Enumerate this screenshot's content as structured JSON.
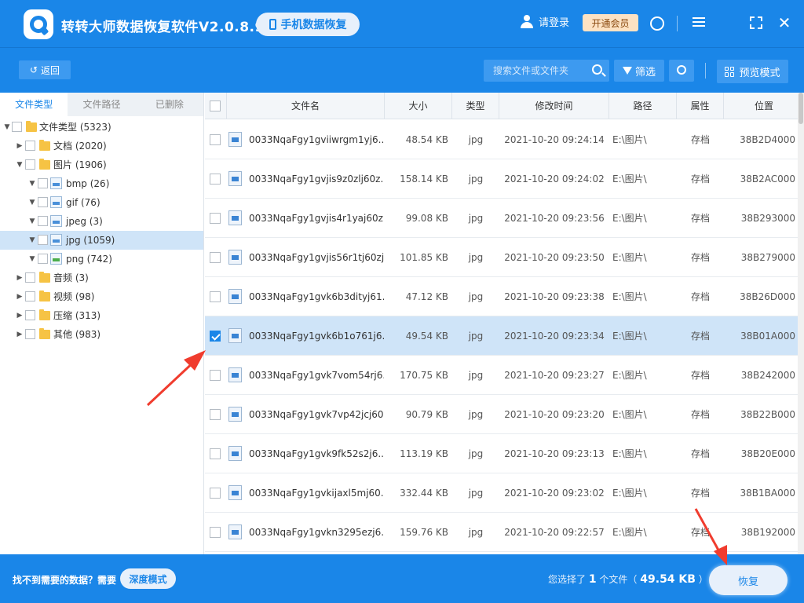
{
  "app": {
    "title": "转转大师数据恢复软件V2.0.8.9",
    "mobile_btn": "手机数据恢复",
    "login": "请登录",
    "vip": "开通会员"
  },
  "toolbar": {
    "back": "返回",
    "search_placeholder": "搜索文件或文件夹",
    "filter": "筛选",
    "preview_mode": "预览模式"
  },
  "sidebar": {
    "tabs": [
      "文件类型",
      "文件路径",
      "已删除"
    ],
    "tree": [
      {
        "label": "文件类型 (5323)"
      },
      {
        "label": "文档 (2020)"
      },
      {
        "label": "图片 (1906)"
      },
      {
        "label": "bmp (26)"
      },
      {
        "label": "gif (76)"
      },
      {
        "label": "jpeg (3)"
      },
      {
        "label": "jpg (1059)"
      },
      {
        "label": "png (742)"
      },
      {
        "label": "音频 (3)"
      },
      {
        "label": "视频 (98)"
      },
      {
        "label": "压缩 (313)"
      },
      {
        "label": "其他 (983)"
      }
    ]
  },
  "table": {
    "columns": [
      "文件名",
      "大小",
      "类型",
      "修改时间",
      "路径",
      "属性",
      "位置"
    ],
    "rows": [
      {
        "name": "0033NqaFgy1gviiwrgm1yj6...",
        "size": "48.54 KB",
        "type": "jpg",
        "time": "2021-10-20 09:24:14",
        "path": "E:\\图片\\",
        "attr": "存档",
        "pos": "38B2D4000",
        "checked": false
      },
      {
        "name": "0033NqaFgy1gvjis9z0zlj60z...",
        "size": "158.14 KB",
        "type": "jpg",
        "time": "2021-10-20 09:24:02",
        "path": "E:\\图片\\",
        "attr": "存档",
        "pos": "38B2AC000",
        "checked": false
      },
      {
        "name": "0033NqaFgy1gvjis4r1yaj60z...",
        "size": "99.08 KB",
        "type": "jpg",
        "time": "2021-10-20 09:23:56",
        "path": "E:\\图片\\",
        "attr": "存档",
        "pos": "38B293000",
        "checked": false
      },
      {
        "name": "0033NqaFgy1gvjis56r1tj60zj...",
        "size": "101.85 KB",
        "type": "jpg",
        "time": "2021-10-20 09:23:50",
        "path": "E:\\图片\\",
        "attr": "存档",
        "pos": "38B279000",
        "checked": false
      },
      {
        "name": "0033NqaFgy1gvk6b3dityj61...",
        "size": "47.12 KB",
        "type": "jpg",
        "time": "2021-10-20 09:23:38",
        "path": "E:\\图片\\",
        "attr": "存档",
        "pos": "38B26D000",
        "checked": false
      },
      {
        "name": "0033NqaFgy1gvk6b1o761j6...",
        "size": "49.54 KB",
        "type": "jpg",
        "time": "2021-10-20 09:23:34",
        "path": "E:\\图片\\",
        "attr": "存档",
        "pos": "38B01A000",
        "checked": true
      },
      {
        "name": "0033NqaFgy1gvk7vom54rj6...",
        "size": "170.75 KB",
        "type": "jpg",
        "time": "2021-10-20 09:23:27",
        "path": "E:\\图片\\",
        "attr": "存档",
        "pos": "38B242000",
        "checked": false
      },
      {
        "name": "0033NqaFgy1gvk7vp42jcj60...",
        "size": "90.79 KB",
        "type": "jpg",
        "time": "2021-10-20 09:23:20",
        "path": "E:\\图片\\",
        "attr": "存档",
        "pos": "38B22B000",
        "checked": false
      },
      {
        "name": "0033NqaFgy1gvk9fk52s2j6...",
        "size": "113.19 KB",
        "type": "jpg",
        "time": "2021-10-20 09:23:13",
        "path": "E:\\图片\\",
        "attr": "存档",
        "pos": "38B20E000",
        "checked": false
      },
      {
        "name": "0033NqaFgy1gvkijaxl5mj60...",
        "size": "332.44 KB",
        "type": "jpg",
        "time": "2021-10-20 09:23:02",
        "path": "E:\\图片\\",
        "attr": "存档",
        "pos": "38B1BA000",
        "checked": false
      },
      {
        "name": "0033NqaFgy1gvkn3295ezj6...",
        "size": "159.76 KB",
        "type": "jpg",
        "time": "2021-10-20 09:22:57",
        "path": "E:\\图片\\",
        "attr": "存档",
        "pos": "38B192000",
        "checked": false
      }
    ]
  },
  "footer": {
    "hint": "找不到需要的数据？需要",
    "deep_mode": "深度模式",
    "selected_prefix": "您选择了",
    "selected_count": "1",
    "selected_unit": "个文件（",
    "selected_size": "49.54 KB",
    "selected_suffix": "）",
    "recover": "恢复"
  },
  "colors": {
    "primary": "#1a86e8",
    "selected_row": "#cfe4f8",
    "vip_bg": "#fde2c3",
    "annotation_arrow": "#f03c2e"
  }
}
